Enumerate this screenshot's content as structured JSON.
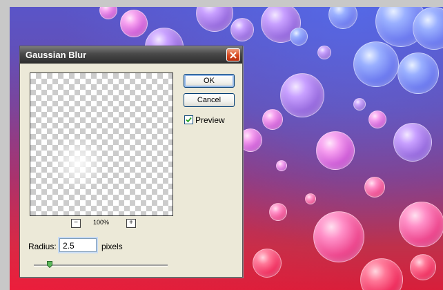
{
  "dialog": {
    "title": "Gaussian Blur",
    "ok_label": "OK",
    "cancel_label": "Cancel",
    "preview_label": "Preview",
    "preview_checked": true,
    "zoom_minus": "−",
    "zoom_plus": "+",
    "zoom_level": "100%",
    "radius_label": "Radius:",
    "radius_value": "2.5",
    "radius_units": "pixels",
    "radius_slider_fraction": 0.12
  },
  "icons": {
    "close": "close-icon",
    "check": "check-icon",
    "slider": "slider-thumb-icon"
  },
  "colors": {
    "dialog_bg": "#ece9d8",
    "close_button": "#d84820",
    "ok_focus_ring": "#94b8e8",
    "input_focus": "#c9dcf5"
  }
}
